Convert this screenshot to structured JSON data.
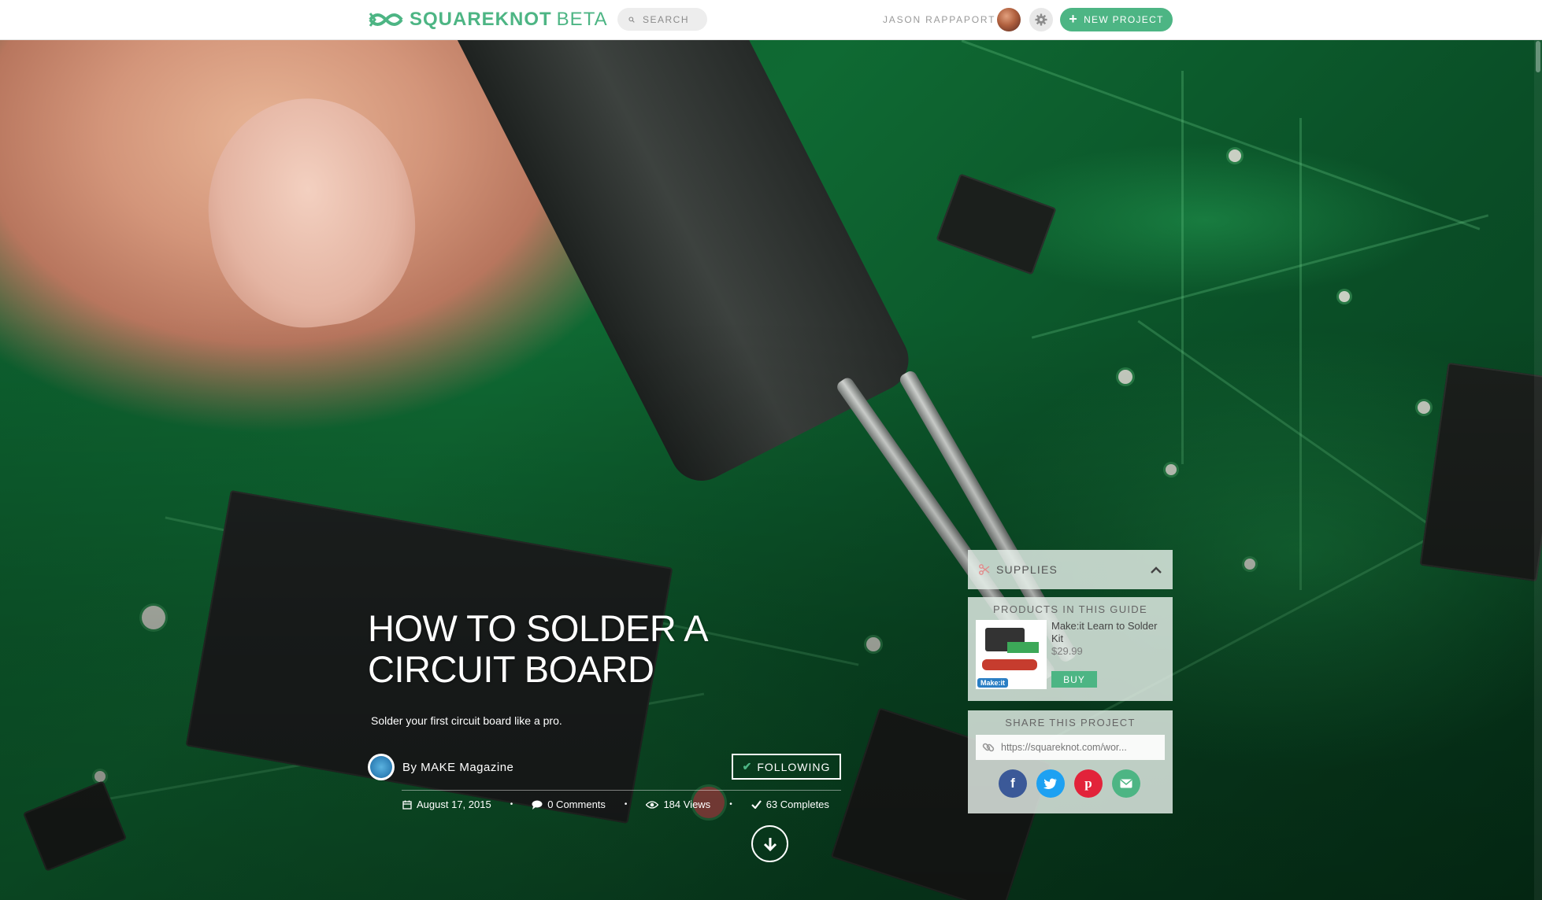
{
  "nav": {
    "logo_name": "SQUAREKNOT",
    "logo_beta": "BETA",
    "search_placeholder": "SEARCH",
    "username": "JASON RAPPAPORT",
    "new_project_label": "NEW PROJECT"
  },
  "hero": {
    "title": "HOW TO SOLDER A CIRCUIT BOARD",
    "subtitle": "Solder your first circuit board like a pro.",
    "author": "By MAKE Magazine",
    "following_label": "FOLLOWING",
    "meta": {
      "date": "August 17, 2015",
      "comments": "0 Comments",
      "views": "184 Views",
      "completes": "63 Completes"
    }
  },
  "sidebar": {
    "supplies_label": "SUPPLIES",
    "products_title": "PRODUCTS IN THIS GUIDE",
    "product": {
      "name": "Make:it Learn to Solder Kit",
      "price": "$29.99",
      "buy_label": "BUY",
      "badge": "Make:it"
    },
    "share_title": "SHARE THIS PROJECT",
    "share_url": "https://squareknot.com/wor..."
  },
  "colors": {
    "brand_green": "#4db584",
    "facebook": "#3b5998",
    "twitter": "#1da1f2",
    "pinterest": "#e2233a",
    "email": "#4db584"
  },
  "icons": [
    "logo-knot-icon",
    "search-icon",
    "avatar",
    "gear-icon",
    "plus-icon",
    "calendar-icon",
    "comment-icon",
    "eye-icon",
    "check-icon",
    "arrow-down-icon",
    "scissors-icon",
    "chevron-up-icon",
    "link-icon",
    "facebook-icon",
    "twitter-icon",
    "pinterest-icon",
    "email-icon"
  ]
}
